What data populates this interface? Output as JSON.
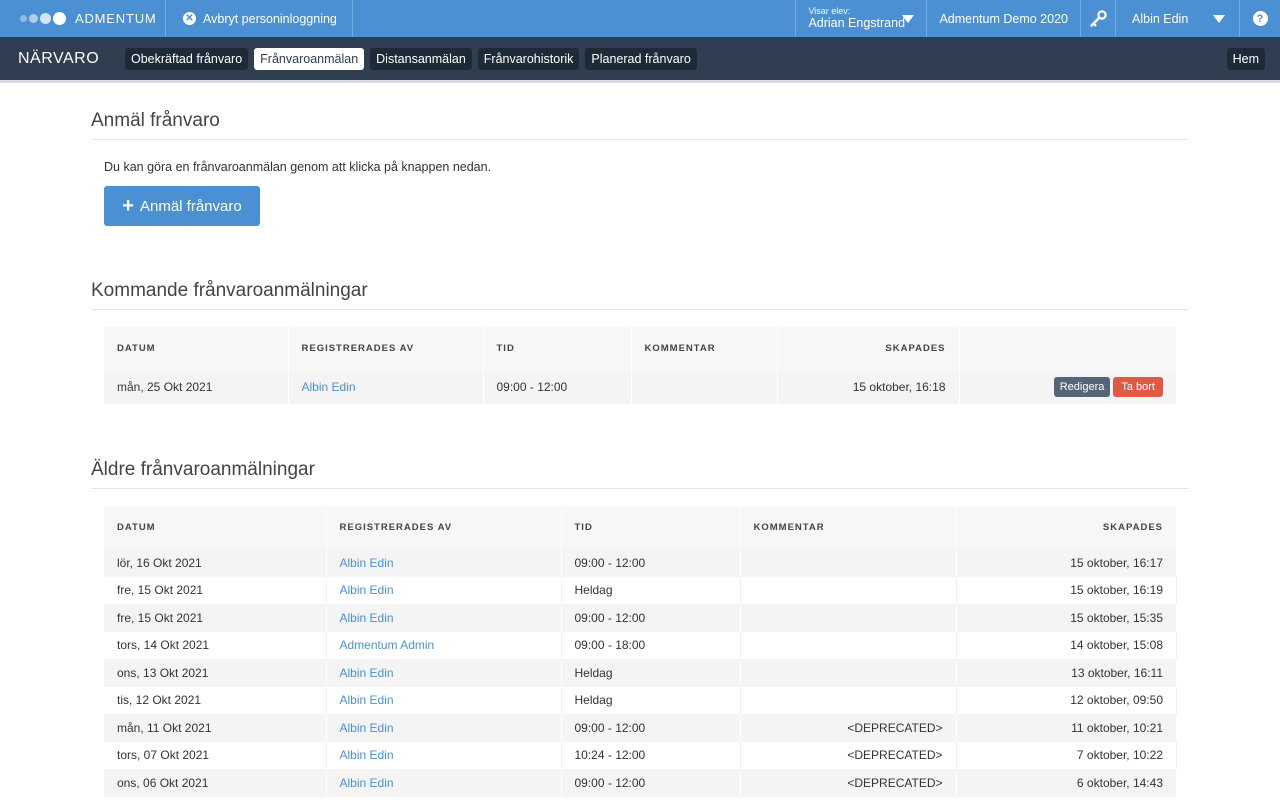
{
  "topbar": {
    "brand": "ADMENTUM",
    "abort_label": "Avbryt personinloggning",
    "viewing_label": "Visar elev:",
    "viewing_student": "Adrian Engstrand",
    "demo_label": "Admentum Demo 2020",
    "user_name": "Albin Edin",
    "help": "?"
  },
  "nav": {
    "title": "NÄRVARO",
    "tabs": [
      {
        "label": "Obekräftad frånvaro"
      },
      {
        "label": "Frånvaroanmälan"
      },
      {
        "label": "Distansanmälan"
      },
      {
        "label": "Frånvarohistorik"
      },
      {
        "label": "Planerad frånvaro"
      }
    ],
    "home": "Hem"
  },
  "report": {
    "heading": "Anmäl frånvaro",
    "intro": "Du kan göra en frånvaroanmälan genom att klicka på knappen nedan.",
    "button_label": "Anmäl frånvaro"
  },
  "upcoming": {
    "heading": "Kommande frånvaroanmälningar",
    "columns": [
      "DATUM",
      "REGISTRERADES AV",
      "TID",
      "KOMMENTAR",
      "SKAPADES"
    ],
    "rows": [
      {
        "date": "mån, 25 Okt 2021",
        "by": "Albin Edin",
        "time": "09:00 - 12:00",
        "comment": "",
        "created": "15 oktober, 16:18",
        "edit": "Redigera",
        "delete": "Ta bort"
      }
    ]
  },
  "older": {
    "heading": "Äldre frånvaroanmälningar",
    "columns": [
      "DATUM",
      "REGISTRERADES AV",
      "TID",
      "KOMMENTAR",
      "SKAPADES"
    ],
    "rows": [
      {
        "date": "lör, 16 Okt 2021",
        "by": "Albin Edin",
        "time": "09:00 - 12:00",
        "comment": "",
        "created": "15 oktober, 16:17"
      },
      {
        "date": "fre, 15 Okt 2021",
        "by": "Albin Edin",
        "time": "Heldag",
        "comment": "",
        "created": "15 oktober, 16:19"
      },
      {
        "date": "fre, 15 Okt 2021",
        "by": "Albin Edin",
        "time": "09:00 - 12:00",
        "comment": "",
        "created": "15 oktober, 15:35"
      },
      {
        "date": "tors, 14 Okt 2021",
        "by": "Admentum Admin",
        "time": "09:00 - 18:00",
        "comment": "",
        "created": "14 oktober, 15:08"
      },
      {
        "date": "ons, 13 Okt 2021",
        "by": "Albin Edin",
        "time": "Heldag",
        "comment": "",
        "created": "13 oktober, 16:11"
      },
      {
        "date": "tis, 12 Okt 2021",
        "by": "Albin Edin",
        "time": "Heldag",
        "comment": "",
        "created": "12 oktober, 09:50"
      },
      {
        "date": "mån, 11 Okt 2021",
        "by": "Albin Edin",
        "time": "09:00 - 12:00",
        "comment": "<DEPRECATED>",
        "created": "11 oktober, 10:21"
      },
      {
        "date": "tors, 07 Okt 2021",
        "by": "Albin Edin",
        "time": "10:24 - 12:00",
        "comment": "<DEPRECATED>",
        "created": "7 oktober, 10:22"
      },
      {
        "date": "ons, 06 Okt 2021",
        "by": "Albin Edin",
        "time": "09:00 - 12:00",
        "comment": "<DEPRECATED>",
        "created": "6 oktober, 14:43"
      }
    ]
  },
  "colors": {
    "topbar": "#4a90d3",
    "navbar": "#2f3e50",
    "link": "#4a90d3",
    "edit_button": "#56647a",
    "delete_button": "#df5a45"
  }
}
